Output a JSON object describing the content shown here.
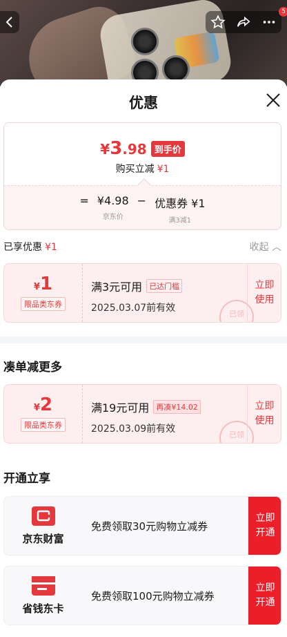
{
  "sheet": {
    "title": "优惠"
  },
  "top_badge": "5",
  "price": {
    "currency": "¥",
    "integer": "3",
    "decimal": ".98",
    "final_tag": "到手价",
    "buy_reduce_label": "购买立减",
    "buy_reduce_value": "¥1",
    "calc": {
      "equals": "=",
      "jd_price": "¥4.98",
      "jd_price_label": "京东价",
      "minus": "−",
      "coupon": "优惠券 ¥1",
      "coupon_label": "满3减1"
    }
  },
  "enjoyed": {
    "label": "已享优惠",
    "value": "¥1",
    "collapse": "收起"
  },
  "coupons": [
    {
      "currency": "¥",
      "amount": "1",
      "type": "限品类东券",
      "condition": "满3元可用",
      "tag": "已达门槛",
      "date": "2025.03.07前有效",
      "action": "立即使用",
      "stamp": "已领"
    },
    {
      "currency": "¥",
      "amount": "2",
      "type": "限品类东券",
      "condition": "满19元可用",
      "tag": "再凑¥14.02",
      "date": "2025.03.09前有效",
      "action": "立即使用",
      "stamp": "已领"
    }
  ],
  "sections": {
    "more": "凑单减更多",
    "open": "开通立享"
  },
  "open_cards": [
    {
      "name": "京东财富",
      "text": "免费领取30元购物立减券",
      "action": "立即开通",
      "icon": "jd-finance-icon"
    },
    {
      "name": "省钱东卡",
      "text": "免费领取100元购物立减券",
      "action": "立即开通",
      "icon": "card-icon"
    }
  ],
  "colors": {
    "accent": "#e4393c",
    "button_red": "#ea1f2a"
  }
}
